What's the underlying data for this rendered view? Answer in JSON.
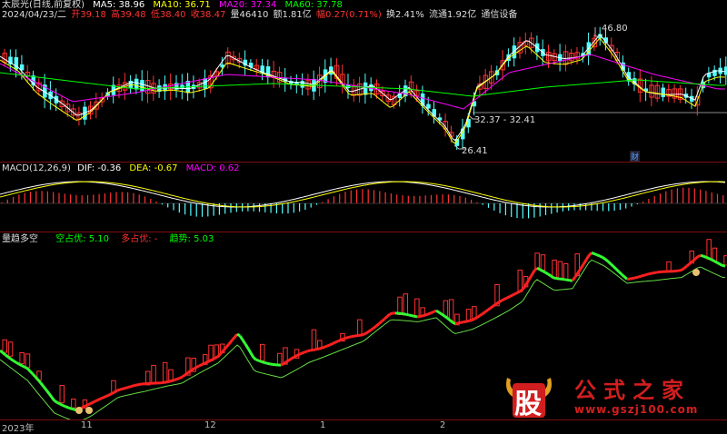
{
  "main": {
    "line1": {
      "stock": "太辰光(日线,前复权)",
      "ma5": "MA5: 38.96",
      "ma10": "MA10: 36.71",
      "ma20": "MA20: 37.34",
      "ma60": "MA60: 37.78"
    },
    "line2": {
      "date": "2024/04/23/二",
      "open": "开39.18",
      "high": "高39.48",
      "low": "低38.40",
      "close": "收38.47",
      "vol": "量46410",
      "amount": "额1.81亿",
      "change": "幅0.27(0.71%)",
      "turnover": "换2.41%",
      "float": "流通1.92亿",
      "industry": "通信设备"
    },
    "annotations": {
      "high": "46.80",
      "range": "32.37 - 32.41",
      "low": "26.41",
      "cai": "财"
    }
  },
  "macd": {
    "title": "MACD(12,26,9)",
    "dif": "DIF: -0.36",
    "dea": "DEA: -0.67",
    "macd": "MACD: 0.62"
  },
  "trend": {
    "title": "量趋多空",
    "empty": "空占优: 5.10",
    "multi": "多占优: -",
    "trend": "趋势: 5.03"
  },
  "axis": {
    "labels": [
      "2023年",
      "11",
      "12",
      "1",
      "2"
    ]
  },
  "watermark": {
    "big": "股",
    "title": "公式之家",
    "url": "www.gszj100.com"
  },
  "colors": {
    "up": "#ff3232",
    "down": "#54ffff",
    "ma5": "#ffffff",
    "ma10": "#ffff00",
    "ma20": "#ff00ff",
    "ma60": "#00ff00",
    "separator": "#7a1010"
  }
}
